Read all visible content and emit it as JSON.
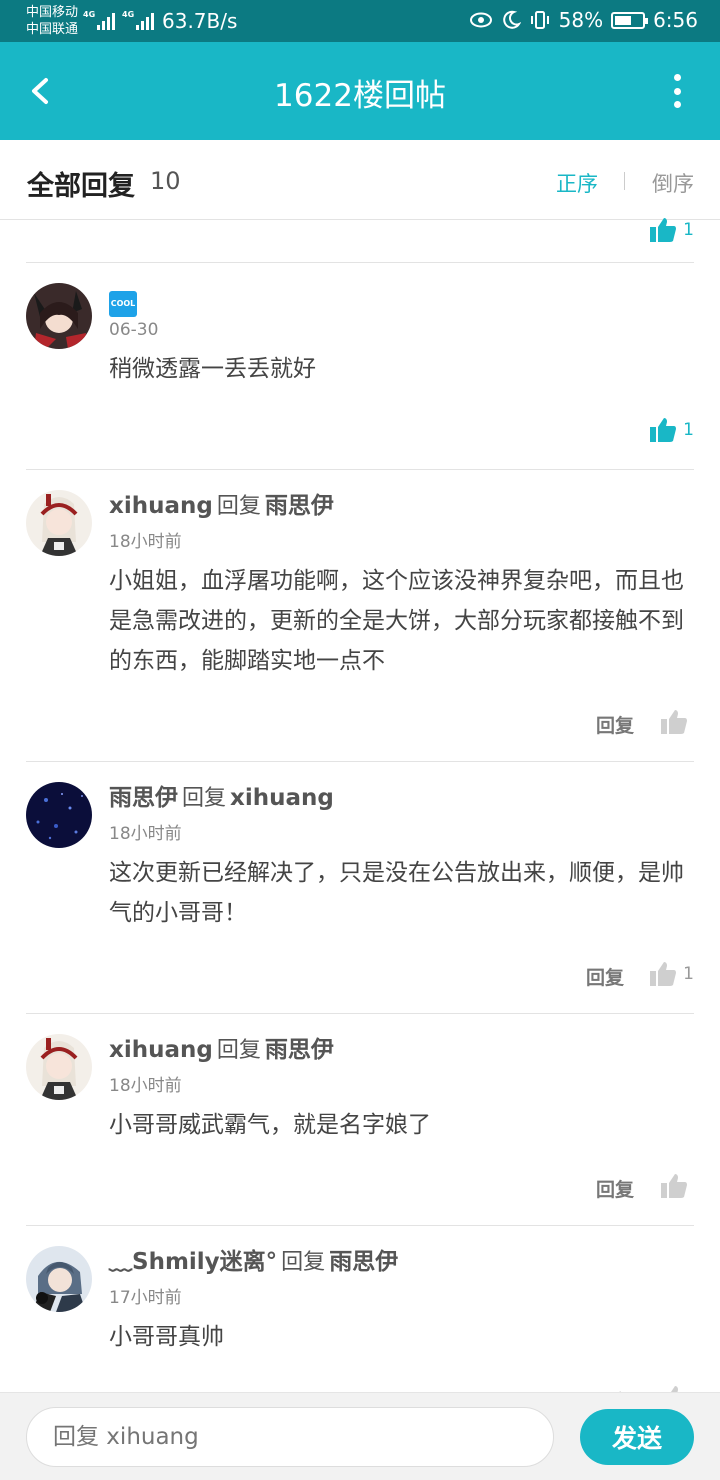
{
  "status_bar": {
    "carrier1": "中国移动",
    "carrier2": "中国联通",
    "net1": "4G",
    "net2": "4G",
    "speed": "63.7B/s",
    "battery": "58%",
    "time": "6:56"
  },
  "header": {
    "title": "1622楼回帖"
  },
  "section": {
    "title": "全部回复",
    "count": "10",
    "sort_asc": "正序",
    "sort_desc": "倒序"
  },
  "cut_item": {
    "likes": "1"
  },
  "comments": [
    {
      "badge": "COOL",
      "date": "06-30",
      "content": "稍微透露一丢丢就好",
      "likes": "1"
    },
    {
      "author": "xihuang",
      "reply_word": "回复",
      "target": "雨思伊",
      "date": "18小时前",
      "content": "小姐姐，血浮屠功能啊，这个应该没神界复杂吧，而且也是急需改进的，更新的全是大饼，大部分玩家都接触不到的东西，能脚踏实地一点不",
      "reply_label": "回复",
      "likes": ""
    },
    {
      "author": "雨思伊",
      "reply_word": "回复",
      "target": "xihuang",
      "date": "18小时前",
      "content": "这次更新已经解决了，只是没在公告放出来，顺便，是帅气的小哥哥！",
      "reply_label": "回复",
      "likes": "1"
    },
    {
      "author": "xihuang",
      "reply_word": "回复",
      "target": "雨思伊",
      "date": "18小时前",
      "content": "小哥哥威武霸气，就是名字娘了",
      "reply_label": "回复",
      "likes": ""
    },
    {
      "author": "﹏Shmily迷离°",
      "reply_word": "回复",
      "target": "雨思伊",
      "date": "17小时前",
      "content": "小哥哥真帅",
      "reply_label": "回复",
      "likes": ""
    }
  ],
  "bottom": {
    "placeholder": "回复 xihuang",
    "send_label": "发送"
  },
  "colors": {
    "accent": "#19b7c6",
    "status_bar": "#0c7a82"
  },
  "icons": {
    "back": "chevron-left-icon",
    "more": "more-vertical-icon",
    "like": "thumbs-up-icon"
  }
}
